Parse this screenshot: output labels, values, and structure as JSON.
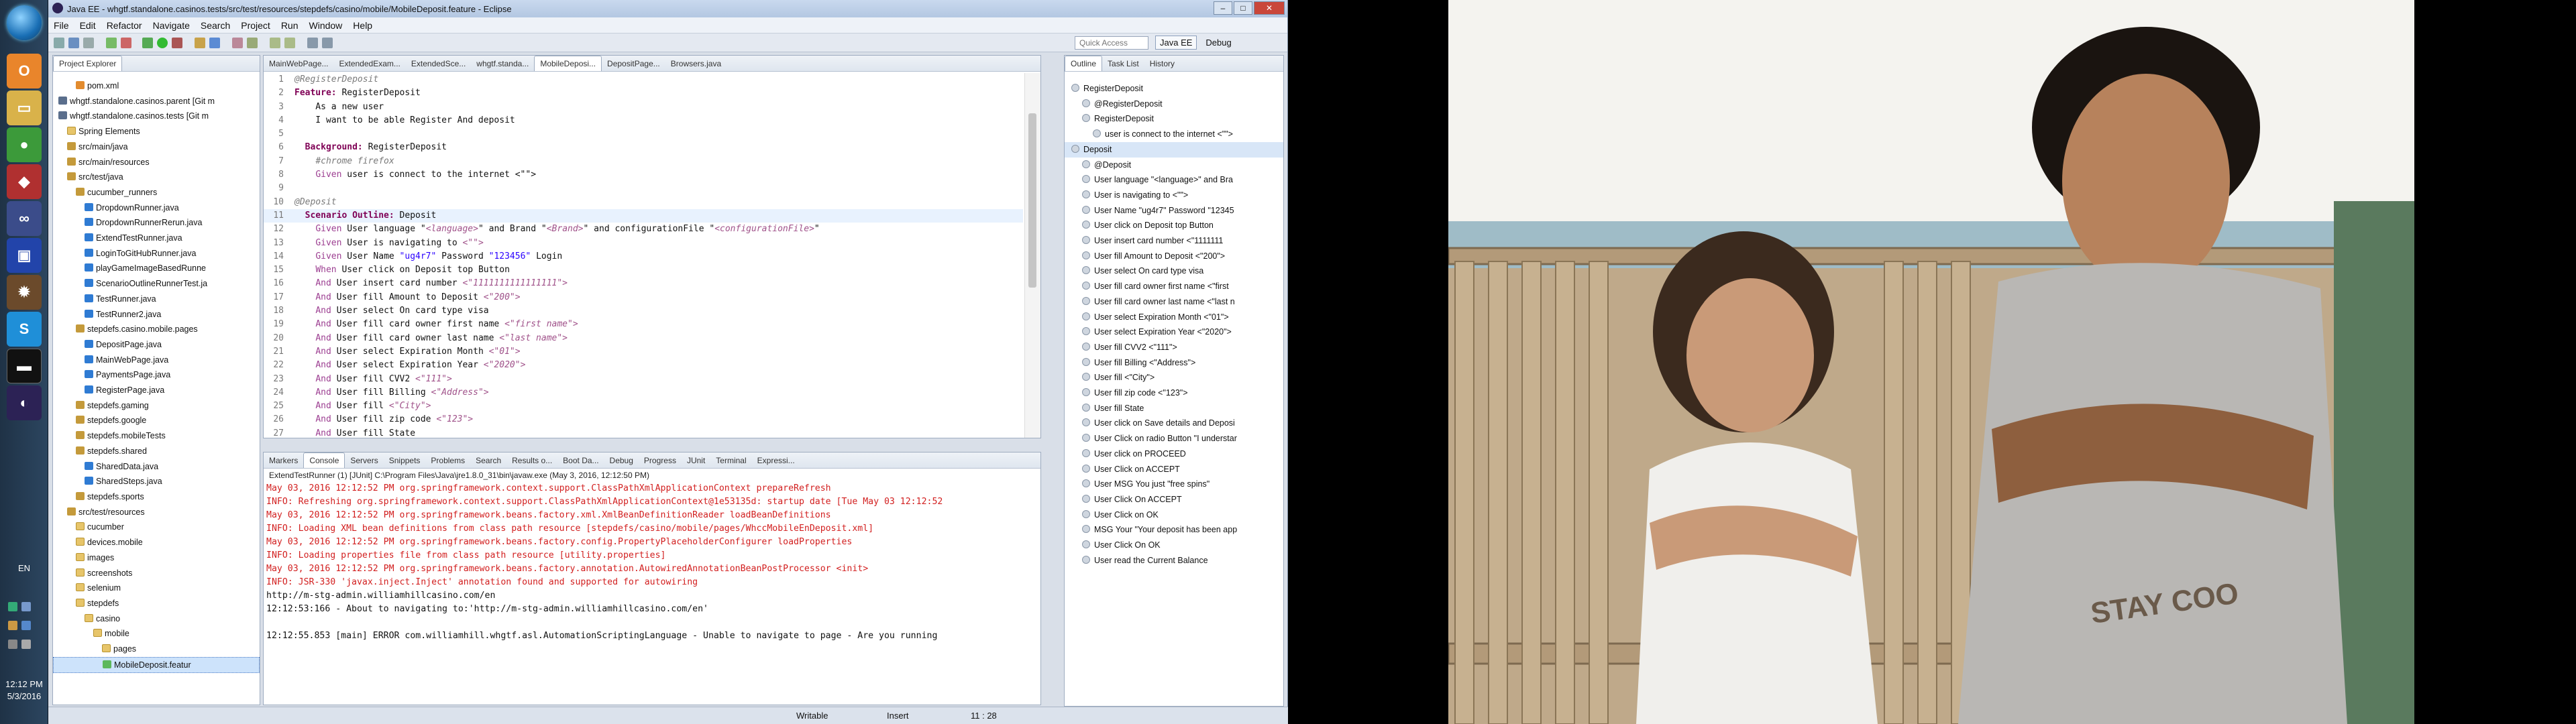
{
  "window": {
    "title": "Java EE - whgtf.standalone.casinos.tests/src/test/resources/stepdefs/casino/mobile/MobileDeposit.feature - Eclipse",
    "controls": [
      "–",
      "□",
      "✕"
    ]
  },
  "menu": [
    "File",
    "Edit",
    "Refactor",
    "Navigate",
    "Search",
    "Project",
    "Run",
    "Window",
    "Help"
  ],
  "toolbar": {
    "quick_access_placeholder": "Quick Access",
    "perspectives": [
      "Java EE",
      "Debug"
    ]
  },
  "explorer": {
    "tab_label": "Project Explorer",
    "tree": [
      {
        "label": "pom.xml",
        "icon": "xml-icon",
        "depth": 2
      },
      {
        "label": "whgtf.standalone.casinos.parent [Git m",
        "icon": "project-icon",
        "depth": 0
      },
      {
        "label": "whgtf.standalone.casinos.tests [Git m",
        "icon": "project-icon",
        "depth": 0
      },
      {
        "label": "Spring Elements",
        "icon": "folder-icon",
        "depth": 1
      },
      {
        "label": "src/main/java",
        "icon": "package-icon",
        "depth": 1
      },
      {
        "label": "src/main/resources",
        "icon": "package-icon",
        "depth": 1
      },
      {
        "label": "src/test/java",
        "icon": "package-icon",
        "depth": 1
      },
      {
        "label": "cucumber_runners",
        "icon": "package-icon",
        "depth": 2
      },
      {
        "label": "DropdownRunner.java",
        "icon": "java-icon",
        "depth": 3
      },
      {
        "label": "DropdownRunnerRerun.java",
        "icon": "java-icon",
        "depth": 3
      },
      {
        "label": "ExtendTestRunner.java",
        "icon": "java-icon",
        "depth": 3
      },
      {
        "label": "LoginToGitHubRunner.java",
        "icon": "java-icon",
        "depth": 3
      },
      {
        "label": "playGameImageBasedRunne",
        "icon": "java-icon",
        "depth": 3
      },
      {
        "label": "ScenarioOutlineRunnerTest.ja",
        "icon": "java-icon",
        "depth": 3
      },
      {
        "label": "TestRunner.java",
        "icon": "java-icon",
        "depth": 3
      },
      {
        "label": "TestRunner2.java",
        "icon": "java-icon",
        "depth": 3
      },
      {
        "label": "stepdefs.casino.mobile.pages",
        "icon": "package-icon",
        "depth": 2
      },
      {
        "label": "DepositPage.java",
        "icon": "java-icon",
        "depth": 3
      },
      {
        "label": "MainWebPage.java",
        "icon": "java-icon",
        "depth": 3
      },
      {
        "label": "PaymentsPage.java",
        "icon": "java-icon",
        "depth": 3
      },
      {
        "label": "RegisterPage.java",
        "icon": "java-icon",
        "depth": 3
      },
      {
        "label": "stepdefs.gaming",
        "icon": "package-icon",
        "depth": 2
      },
      {
        "label": "stepdefs.google",
        "icon": "package-icon",
        "depth": 2
      },
      {
        "label": "stepdefs.mobileTests",
        "icon": "package-icon",
        "depth": 2
      },
      {
        "label": "stepdefs.shared",
        "icon": "package-icon",
        "depth": 2
      },
      {
        "label": "SharedData.java",
        "icon": "java-icon",
        "depth": 3
      },
      {
        "label": "SharedSteps.java",
        "icon": "java-icon",
        "depth": 3
      },
      {
        "label": "stepdefs.sports",
        "icon": "package-icon",
        "depth": 2
      },
      {
        "label": "src/test/resources",
        "icon": "package-icon",
        "depth": 1
      },
      {
        "label": "cucumber",
        "icon": "folder-icon",
        "depth": 2
      },
      {
        "label": "devices.mobile",
        "icon": "folder-icon",
        "depth": 2
      },
      {
        "label": "images",
        "icon": "folder-icon",
        "depth": 2
      },
      {
        "label": "screenshots",
        "icon": "folder-icon",
        "depth": 2
      },
      {
        "label": "selenium",
        "icon": "folder-icon",
        "depth": 2
      },
      {
        "label": "stepdefs",
        "icon": "folder-icon",
        "depth": 2
      },
      {
        "label": "casino",
        "icon": "folder-icon",
        "depth": 3
      },
      {
        "label": "mobile",
        "icon": "folder-icon",
        "depth": 4
      },
      {
        "label": "pages",
        "icon": "folder-icon",
        "depth": 5
      },
      {
        "label": "MobileDeposit.featur",
        "icon": "feature-icon",
        "depth": 5,
        "selected": true
      }
    ]
  },
  "editor": {
    "tabs": [
      "MainWebPage...",
      "ExtendedExam...",
      "ExtendedSce...",
      "whgtf.standa...",
      "MobileDeposi...",
      "DepositPage...",
      "Browsers.java"
    ],
    "active_tab": 4,
    "lines": [
      {
        "n": "1",
        "parts": [
          [
            "tag",
            "@RegisterDeposit"
          ]
        ]
      },
      {
        "n": "2",
        "parts": [
          [
            "kw",
            "Feature:"
          ],
          [
            "",
            " RegisterDeposit"
          ]
        ]
      },
      {
        "n": "3",
        "parts": [
          [
            "",
            "    As a new user"
          ]
        ]
      },
      {
        "n": "4",
        "parts": [
          [
            "",
            "    I want to be able Register And deposit"
          ]
        ]
      },
      {
        "n": "5",
        "parts": [
          [
            "",
            ""
          ]
        ]
      },
      {
        "n": "6",
        "parts": [
          [
            "",
            "  "
          ],
          [
            "kw",
            "Background:"
          ],
          [
            "",
            " RegisterDeposit"
          ]
        ]
      },
      {
        "n": "7",
        "parts": [
          [
            "",
            "    "
          ],
          [
            "tag",
            "#chrome firefox"
          ]
        ]
      },
      {
        "n": "8",
        "parts": [
          [
            "",
            "    "
          ],
          [
            "and",
            "Given"
          ],
          [
            "",
            " user is connect to the internet <\"\">"
          ]
        ]
      },
      {
        "n": "9",
        "parts": [
          [
            "",
            ""
          ]
        ]
      },
      {
        "n": "10",
        "parts": [
          [
            "tag",
            "@Deposit"
          ]
        ]
      },
      {
        "n": "11",
        "parts": [
          [
            "",
            "  "
          ],
          [
            "kw",
            "Scenario Outline:"
          ],
          [
            "",
            " Deposit"
          ]
        ],
        "current": true
      },
      {
        "n": "12",
        "parts": [
          [
            "",
            "    "
          ],
          [
            "and",
            "Given"
          ],
          [
            "",
            " User language \""
          ],
          [
            "ph",
            "<language>"
          ],
          [
            "",
            "\" and Brand \""
          ],
          [
            "ph",
            "<Brand>"
          ],
          [
            "",
            "\" and configurationFile \""
          ],
          [
            "ph",
            "<configurationFile>"
          ],
          [
            "",
            "\""
          ]
        ]
      },
      {
        "n": "13",
        "parts": [
          [
            "",
            "    "
          ],
          [
            "and",
            "Given"
          ],
          [
            "",
            " User is navigating to "
          ],
          [
            "ph",
            "<\"\">"
          ]
        ]
      },
      {
        "n": "14",
        "parts": [
          [
            "",
            "    "
          ],
          [
            "and",
            "Given"
          ],
          [
            "",
            " User Name "
          ],
          [
            "str",
            "\"ug4r7\""
          ],
          [
            "",
            " Password "
          ],
          [
            "str",
            "\"123456\""
          ],
          [
            "",
            " Login"
          ]
        ]
      },
      {
        "n": "15",
        "parts": [
          [
            "",
            "    "
          ],
          [
            "and",
            "When"
          ],
          [
            "",
            " User click on Deposit top Button"
          ]
        ]
      },
      {
        "n": "16",
        "parts": [
          [
            "",
            "    "
          ],
          [
            "and",
            "And"
          ],
          [
            "",
            " User insert card number "
          ],
          [
            "ph",
            "<\"1111111111111111\">"
          ]
        ]
      },
      {
        "n": "17",
        "parts": [
          [
            "",
            "    "
          ],
          [
            "and",
            "And"
          ],
          [
            "",
            " User fill Amount to Deposit "
          ],
          [
            "ph",
            "<\"200\">"
          ]
        ]
      },
      {
        "n": "18",
        "parts": [
          [
            "",
            "    "
          ],
          [
            "and",
            "And"
          ],
          [
            "",
            " User select On card type visa"
          ]
        ]
      },
      {
        "n": "19",
        "parts": [
          [
            "",
            "    "
          ],
          [
            "and",
            "And"
          ],
          [
            "",
            " User fill card owner first name "
          ],
          [
            "ph",
            "<\"first name\">"
          ]
        ]
      },
      {
        "n": "20",
        "parts": [
          [
            "",
            "    "
          ],
          [
            "and",
            "And"
          ],
          [
            "",
            " User fill card owner last name "
          ],
          [
            "ph",
            "<\"last name\">"
          ]
        ]
      },
      {
        "n": "21",
        "parts": [
          [
            "",
            "    "
          ],
          [
            "and",
            "And"
          ],
          [
            "",
            " User select Expiration Month "
          ],
          [
            "ph",
            "<\"01\">"
          ]
        ]
      },
      {
        "n": "22",
        "parts": [
          [
            "",
            "    "
          ],
          [
            "and",
            "And"
          ],
          [
            "",
            " User select Expiration Year "
          ],
          [
            "ph",
            "<\"2020\">"
          ]
        ]
      },
      {
        "n": "23",
        "parts": [
          [
            "",
            "    "
          ],
          [
            "and",
            "And"
          ],
          [
            "",
            " User fill CVV2 "
          ],
          [
            "ph",
            "<\"111\">"
          ]
        ]
      },
      {
        "n": "24",
        "parts": [
          [
            "",
            "    "
          ],
          [
            "and",
            "And"
          ],
          [
            "",
            " User fill Billing "
          ],
          [
            "ph",
            "<\"Address\">"
          ]
        ]
      },
      {
        "n": "25",
        "parts": [
          [
            "",
            "    "
          ],
          [
            "and",
            "And"
          ],
          [
            "",
            " User fill "
          ],
          [
            "ph",
            "<\"City\">"
          ]
        ]
      },
      {
        "n": "26",
        "parts": [
          [
            "",
            "    "
          ],
          [
            "and",
            "And"
          ],
          [
            "",
            " User fill zip code "
          ],
          [
            "ph",
            "<\"123\">"
          ]
        ]
      },
      {
        "n": "27",
        "parts": [
          [
            "",
            "    "
          ],
          [
            "and",
            "And"
          ],
          [
            "",
            " User fill State"
          ]
        ]
      }
    ]
  },
  "outline": {
    "tabs": [
      "Outline",
      "Task List",
      "History"
    ],
    "items": [
      {
        "label": "RegisterDeposit",
        "depth": 0
      },
      {
        "label": "@RegisterDeposit",
        "depth": 1
      },
      {
        "label": "RegisterDeposit",
        "depth": 1
      },
      {
        "label": "user is connect to the internet <\"\">",
        "depth": 2
      },
      {
        "label": "Deposit",
        "depth": 0,
        "selected": true
      },
      {
        "label": "@Deposit",
        "depth": 1
      },
      {
        "label": "User language \"<language>\" and Bra",
        "depth": 1
      },
      {
        "label": "User is navigating to <\"\">",
        "depth": 1
      },
      {
        "label": "User Name \"ug4r7\" Password \"12345",
        "depth": 1
      },
      {
        "label": "User click on Deposit top Button",
        "depth": 1
      },
      {
        "label": "User insert card number <\"1111111",
        "depth": 1
      },
      {
        "label": "User fill Amount to Deposit <\"200\">",
        "depth": 1
      },
      {
        "label": "User select On card type visa",
        "depth": 1
      },
      {
        "label": "User fill card owner first name <\"first",
        "depth": 1
      },
      {
        "label": "User fill card owner last name <\"last n",
        "depth": 1
      },
      {
        "label": "User select Expiration Month <\"01\">",
        "depth": 1
      },
      {
        "label": "User select Expiration Year <\"2020\">",
        "depth": 1
      },
      {
        "label": "User fill CVV2 <\"111\">",
        "depth": 1
      },
      {
        "label": "User fill Billing <\"Address\">",
        "depth": 1
      },
      {
        "label": "User fill <\"City\">",
        "depth": 1
      },
      {
        "label": "User fill zip code <\"123\">",
        "depth": 1
      },
      {
        "label": "User fill State",
        "depth": 1
      },
      {
        "label": "User click on Save details and Deposi",
        "depth": 1
      },
      {
        "label": "User Click on radio Button \"I understar",
        "depth": 1
      },
      {
        "label": "User click on PROCEED",
        "depth": 1
      },
      {
        "label": "User Click on ACCEPT",
        "depth": 1
      },
      {
        "label": "User MSG You just \"free spins\"",
        "depth": 1
      },
      {
        "label": "User Click On ACCEPT",
        "depth": 1
      },
      {
        "label": "User Click on OK",
        "depth": 1
      },
      {
        "label": "MSG Your \"Your deposit has been app",
        "depth": 1
      },
      {
        "label": "User Click On OK",
        "depth": 1
      },
      {
        "label": "User read the Current Balance",
        "depth": 1
      }
    ]
  },
  "console": {
    "tabs": [
      "Markers",
      "Console",
      "Servers",
      "Snippets",
      "Problems",
      "Search",
      "Results o...",
      "Boot Da...",
      "Debug",
      "Progress",
      "JUnit",
      "Terminal",
      "Expressi..."
    ],
    "active_tab": 1,
    "header": "ExtendTestRunner (1) [JUnit] C:\\Program Files\\Java\\jre1.8.0_31\\bin\\javaw.exe (May 3, 2016, 12:12:50 PM)",
    "lines": [
      {
        "type": "err",
        "text": "May 03, 2016 12:12:52 PM org.springframework.context.support.ClassPathXmlApplicationContext prepareRefresh"
      },
      {
        "type": "err",
        "text": "INFO: Refreshing org.springframework.context.support.ClassPathXmlApplicationContext@1e53135d: startup date [Tue May 03 12:12:52"
      },
      {
        "type": "err",
        "text": "May 03, 2016 12:12:52 PM org.springframework.beans.factory.xml.XmlBeanDefinitionReader loadBeanDefinitions"
      },
      {
        "type": "err",
        "text": "INFO: Loading XML bean definitions from class path resource [stepdefs/casino/mobile/pages/WhccMobileEnDeposit.xml]"
      },
      {
        "type": "err",
        "text": "May 03, 2016 12:12:52 PM org.springframework.beans.factory.config.PropertyPlaceholderConfigurer loadProperties"
      },
      {
        "type": "err",
        "text": "INFO: Loading properties file from class path resource [utility.properties]"
      },
      {
        "type": "err",
        "text": "May 03, 2016 12:12:52 PM org.springframework.beans.factory.annotation.AutowiredAnnotationBeanPostProcessor <init>"
      },
      {
        "type": "err",
        "text": "INFO: JSR-330 'javax.inject.Inject' annotation found and supported for autowiring"
      },
      {
        "type": "out",
        "text": "http://m-stg-admin.williamhillcasino.com/en"
      },
      {
        "type": "out",
        "text": "12:12:53:166 - About to navigating to:'http://m-stg-admin.williamhillcasino.com/en'"
      },
      {
        "type": "out",
        "text": ""
      },
      {
        "type": "out",
        "text": "12:12:55.853 [main] ERROR com.williamhill.whgtf.asl.AutomationScriptingLanguage - Unable to navigate to page - Are you running"
      }
    ]
  },
  "status": {
    "writable": "Writable",
    "insert": "Insert",
    "position": "11 : 28"
  },
  "taskbar": {
    "language": "EN",
    "time": "12:12 PM",
    "date": "5/3/2016"
  }
}
